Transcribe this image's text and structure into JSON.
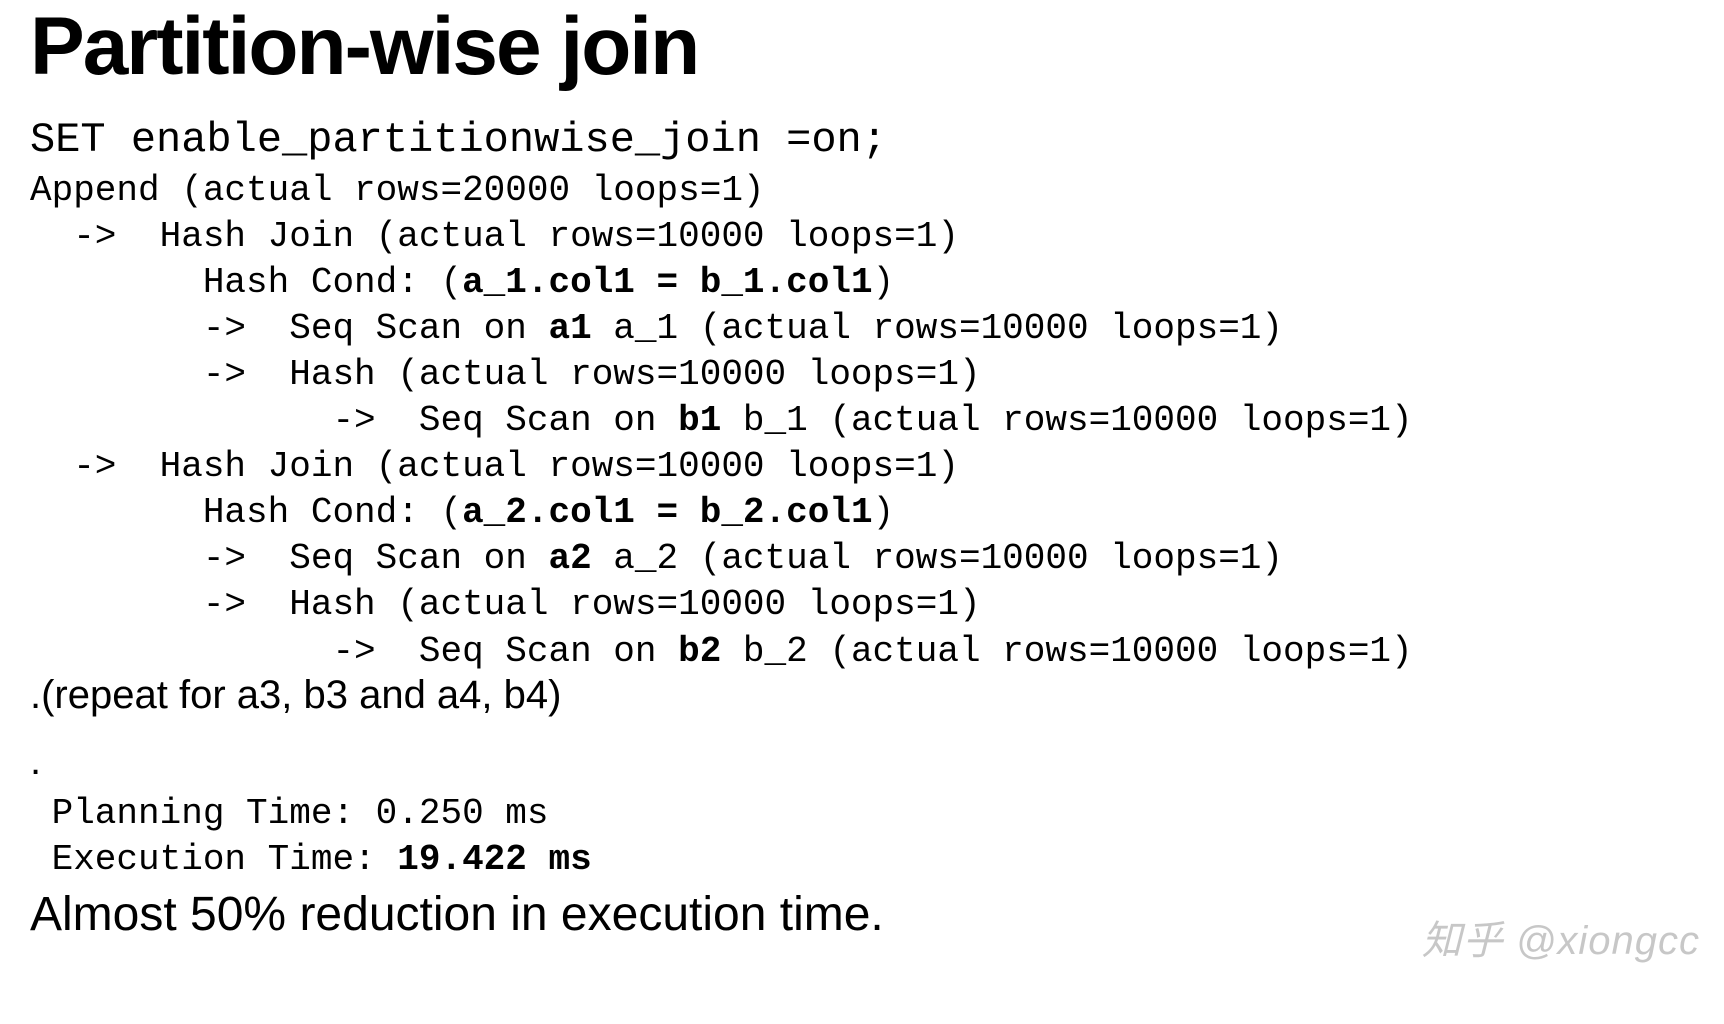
{
  "title": "Partition-wise join",
  "set_line": "SET enable_partitionwise_join =on;",
  "plan": {
    "append": "Append (actual rows=20000 loops=1)",
    "hj1": "  ->  Hash Join (actual rows=10000 loops=1)",
    "cond1_pre": "        Hash Cond: (",
    "cond1_bold": "a_1.col1 = b_1.col1",
    "cond1_post": ")",
    "ss_a1_pre": "        ->  Seq Scan on ",
    "ss_a1_bold": "a1",
    "ss_a1_post": " a_1 (actual rows=10000 loops=1)",
    "hash1": "        ->  Hash (actual rows=10000 loops=1)",
    "ss_b1_pre": "              ->  Seq Scan on ",
    "ss_b1_bold": "b1",
    "ss_b1_post": " b_1 (actual rows=10000 loops=1)",
    "hj2": "  ->  Hash Join (actual rows=10000 loops=1)",
    "cond2_pre": "        Hash Cond: (",
    "cond2_bold": "a_2.col1 = b_2.col1",
    "cond2_post": ")",
    "ss_a2_pre": "        ->  Seq Scan on ",
    "ss_a2_bold": "a2",
    "ss_a2_post": " a_2 (actual rows=10000 loops=1)",
    "hash2": "        ->  Hash (actual rows=10000 loops=1)",
    "ss_b2_pre": "              ->  Seq Scan on ",
    "ss_b2_bold": "b2",
    "ss_b2_post": " b_2 (actual rows=10000 loops=1)"
  },
  "repeat_note": ".(repeat for a3, b3 and a4, b4)",
  "dot": ".",
  "planning_time": " Planning Time: 0.250 ms",
  "exec_time_pre": " Execution Time: ",
  "exec_time_bold": "19.422 ms",
  "conclusion": "Almost 50% reduction in execution time.",
  "watermark": "知乎 @xiongcc"
}
